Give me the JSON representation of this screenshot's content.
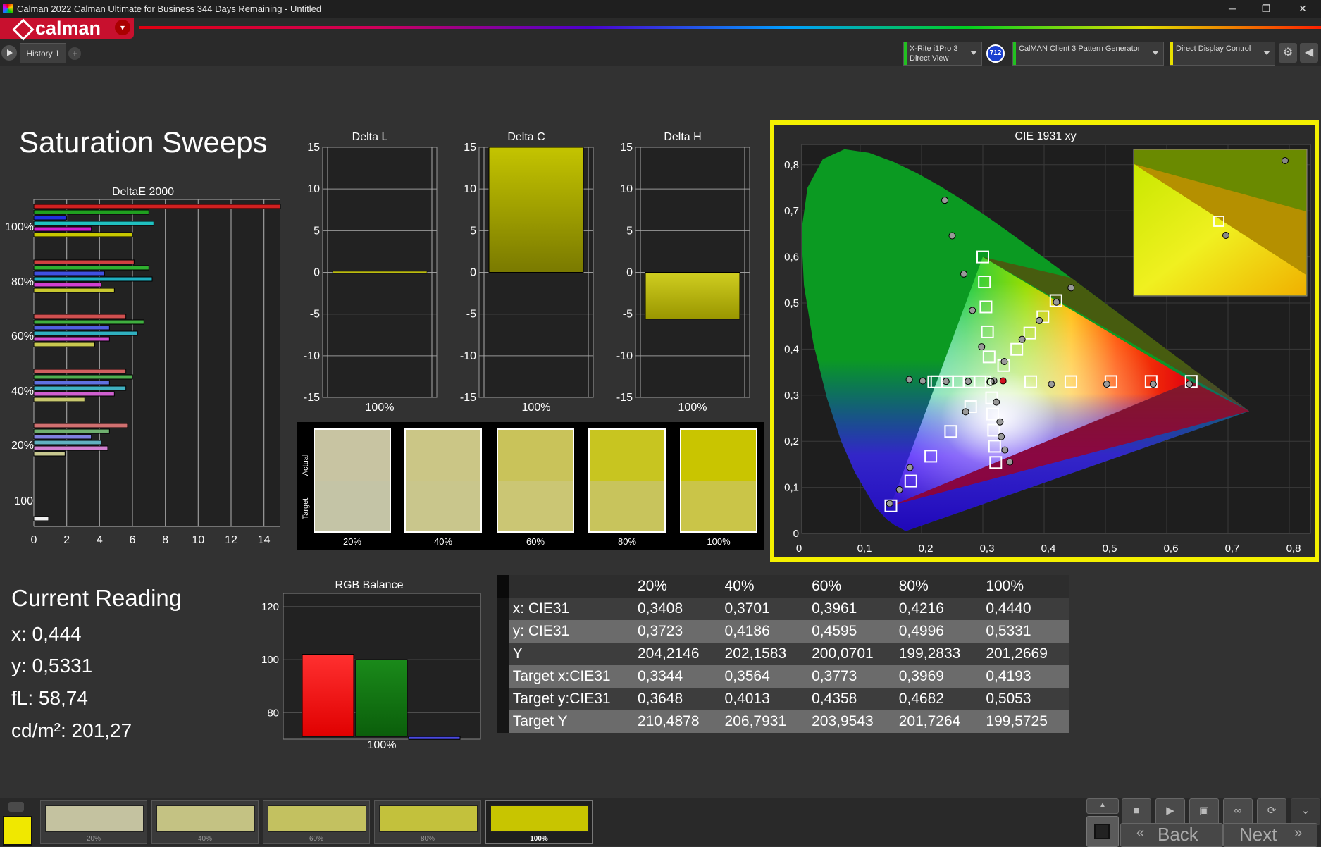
{
  "window": {
    "title": "Calman 2022 Calman Ultimate for Business 344 Days Remaining  - Untitled",
    "minimize": "─",
    "restore": "❐",
    "close": "✕"
  },
  "header": {
    "logo_text": "calman",
    "history_tab": "History 1",
    "add_tab": "+",
    "meter": {
      "line1": "X-Rite i1Pro 3",
      "line2": "Direct View",
      "badge": "712",
      "accent": "#22c020"
    },
    "pattern_generator": {
      "label": "CalMAN Client 3 Pattern Generator",
      "accent": "#22c020"
    },
    "display_control": {
      "label": "Direct Display Control",
      "accent": "#e8e000"
    }
  },
  "page_title": "Saturation Sweeps",
  "deltaE_chart": {
    "title": "DeltaE 2000",
    "x_ticks": [
      "0",
      "2",
      "4",
      "6",
      "8",
      "10",
      "12",
      "14"
    ],
    "group_labels": [
      "100%",
      "80%",
      "60%",
      "40%",
      "20%",
      "100"
    ]
  },
  "delta_charts": [
    {
      "title": "Delta L",
      "x_label": "100%",
      "value": 0.1
    },
    {
      "title": "Delta C",
      "x_label": "100%",
      "value": 15
    },
    {
      "title": "Delta H",
      "x_label": "100%",
      "value": -5.6
    }
  ],
  "delta_y_ticks": [
    "15",
    "10",
    "5",
    "0",
    "-5",
    "-10",
    "-15"
  ],
  "swatches": {
    "actual_label": "Actual",
    "target_label": "Target",
    "labels": [
      "20%",
      "40%",
      "60%",
      "80%",
      "100%"
    ],
    "actual_colors": [
      "#c8c4a2",
      "#cbc686",
      "#c9c35a",
      "#c8c520",
      "#c9c500"
    ],
    "target_colors": [
      "#c4c4a6",
      "#c9c68c",
      "#cbc674",
      "#c8c45c",
      "#cac548"
    ]
  },
  "cie_chart": {
    "title": "CIE 1931 xy",
    "x_ticks": [
      "0",
      "0,1",
      "0,2",
      "0,3",
      "0,4",
      "0,5",
      "0,6",
      "0,7",
      "0,8"
    ],
    "y_ticks": [
      "0",
      "0,1",
      "0,2",
      "0,3",
      "0,4",
      "0,5",
      "0,6",
      "0,7",
      "0,8"
    ]
  },
  "current_reading": {
    "title": "Current Reading",
    "x": "x: 0,444",
    "y": "y: 0,5331",
    "fl": "fL: 58,74",
    "cdm2": "cd/m²: 201,27"
  },
  "rgb_balance": {
    "title": "RGB Balance",
    "y_ticks": [
      "120",
      "100",
      "80"
    ],
    "x_label": "100%",
    "values": {
      "red": 102,
      "green": 100,
      "blue": 71
    }
  },
  "table": {
    "headers": [
      "",
      "20%",
      "40%",
      "60%",
      "80%",
      "100%"
    ],
    "rows": [
      [
        "x: CIE31",
        "0,3408",
        "0,3701",
        "0,3961",
        "0,4216",
        "0,4440"
      ],
      [
        "y: CIE31",
        "0,3723",
        "0,4186",
        "0,4595",
        "0,4996",
        "0,5331"
      ],
      [
        "Y",
        "204,2146",
        "202,1583",
        "200,0701",
        "199,2833",
        "201,2669"
      ],
      [
        "Target x:CIE31",
        "0,3344",
        "0,3564",
        "0,3773",
        "0,3969",
        "0,4193"
      ],
      [
        "Target y:CIE31",
        "0,3648",
        "0,4013",
        "0,4358",
        "0,4682",
        "0,5053"
      ],
      [
        "Target Y",
        "210,4878",
        "206,7931",
        "203,9543",
        "201,7264",
        "199,5725"
      ]
    ]
  },
  "bottom": {
    "thumb_labels": [
      "20%",
      "40%",
      "60%",
      "80%",
      "100%"
    ],
    "thumb_colors": [
      "#c4c2a0",
      "#c4c283",
      "#c3c160",
      "#c3c13c",
      "#c8c500"
    ],
    "back_label": "Back",
    "next_label": "Next",
    "current_color": "#f0e800"
  }
}
